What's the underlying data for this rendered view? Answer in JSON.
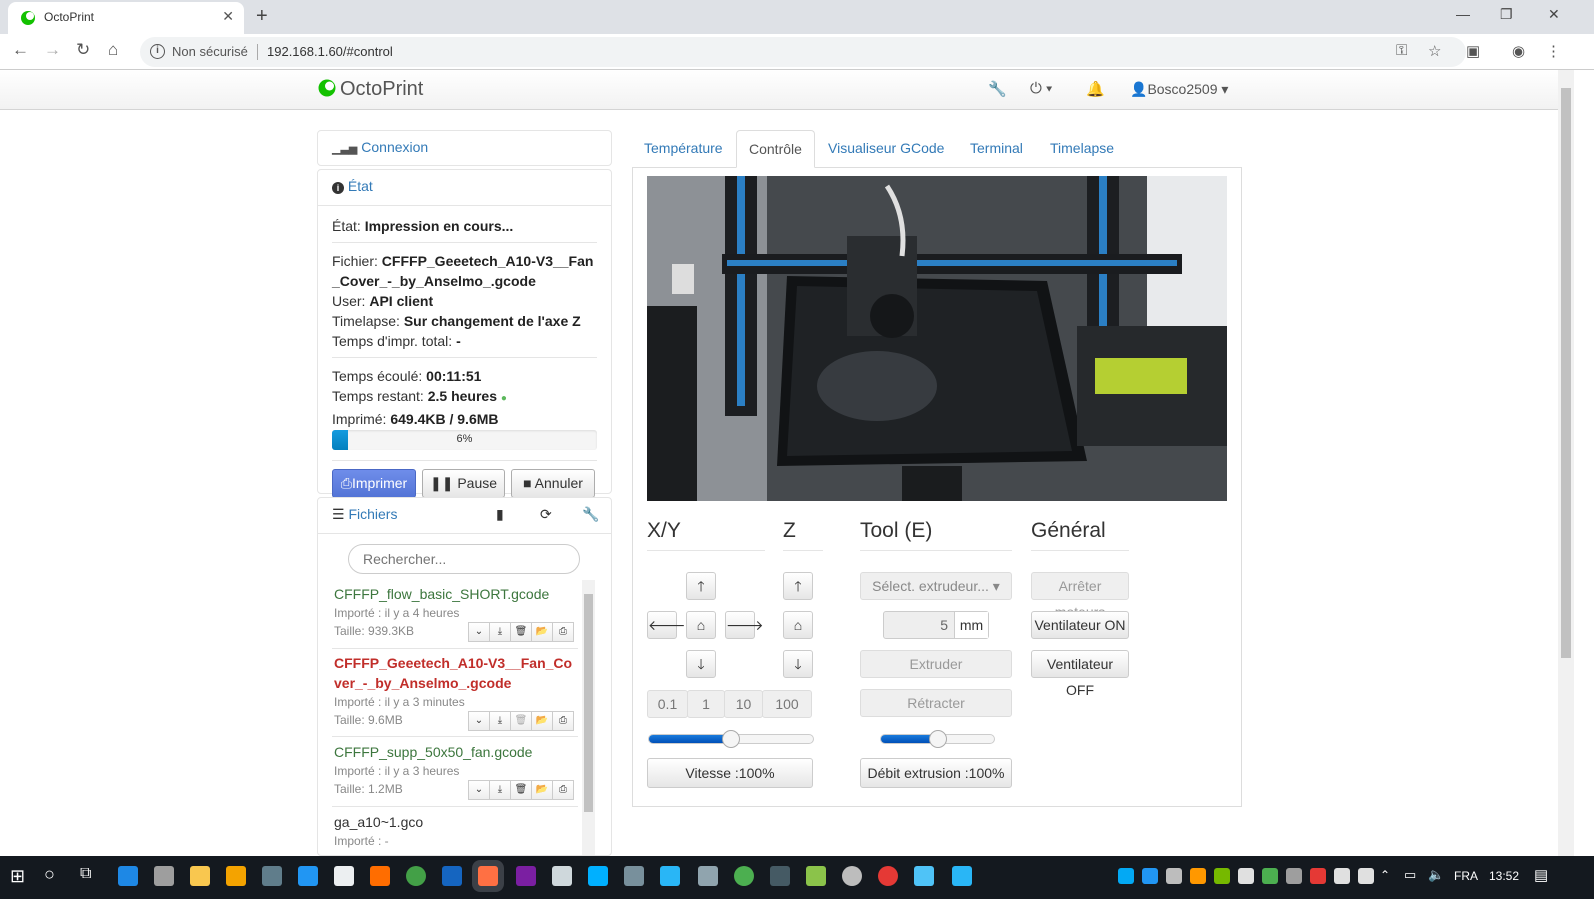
{
  "browser": {
    "tab_title": "OctoPrint",
    "security": "Non sécurisé",
    "url": "192.168.1.60/#control"
  },
  "navbar": {
    "brand": "OctoPrint",
    "user": "Bosco2509"
  },
  "connection": {
    "title": "Connexion"
  },
  "state": {
    "title": "État",
    "etat_label": "État:",
    "etat_value": "Impression en cours...",
    "fichier_label": "Fichier:",
    "fichier_value": "CFFFP_Geeetech_A10-V3__Fan_Cover_-_by_Anselmo_.gcode",
    "user_label": "User:",
    "user_value": "API client",
    "timelapse_label": "Timelapse:",
    "timelapse_value": "Sur changement de l'axe Z",
    "total_label": "Temps d'impr. total:",
    "total_value": "-",
    "elapsed_label": "Temps écoulé:",
    "elapsed_value": "00:11:51",
    "left_label": "Temps restant:",
    "left_value": "2.5 heures",
    "printed_label": "Imprimé:",
    "printed_value": "649.4KB / 9.6MB",
    "progress_label": "6%",
    "progress": 6,
    "btn_print": "Imprimer",
    "btn_pause": "Pause",
    "btn_cancel": "Annuler"
  },
  "files": {
    "title": "Fichiers",
    "search_placeholder": "Rechercher...",
    "items": [
      {
        "name": "CFFFP_flow_basic_SHORT.gcode",
        "uploaded": "Importé : il y a 4 heures",
        "size": "Taille: 939.3KB"
      },
      {
        "name": "CFFFP_Geeetech_A10-V3__Fan_Co",
        "name2": "ver_-_by_Anselmo_.gcode",
        "uploaded": "Importé : il y a 3 minutes",
        "size": "Taille: 9.6MB"
      },
      {
        "name": "CFFFP_supp_50x50_fan.gcode",
        "uploaded": "Importé : il y a 3 heures",
        "size": "Taille: 1.2MB"
      },
      {
        "name": "ga_a10~1.gco",
        "uploaded": "Importé : -"
      }
    ]
  },
  "tabs": [
    "Température",
    "Contrôle",
    "Visualiseur GCode",
    "Terminal",
    "Timelapse"
  ],
  "control": {
    "xy_title": "X/Y",
    "z_title": "Z",
    "tool_title": "Tool (E)",
    "general_title": "Général",
    "steps": [
      "0.1",
      "1",
      "10",
      "100"
    ],
    "speed_label": "Vitesse :100%",
    "speed_value": 0.5,
    "extruder_select": "Sélect. extrudeur...",
    "extrude_amount": "5",
    "unit": "mm",
    "btn_extrude": "Extruder",
    "btn_retract": "Rétracter",
    "flow_label": "Débit extrusion :100%",
    "flow_value": 0.5,
    "btn_motors_off": "Arrêter moteurs",
    "btn_fan_on": "Ventilateur ON",
    "btn_fan_off": "Ventilateur OFF"
  },
  "taskbar": {
    "lang": "FRA",
    "time": "13:52"
  },
  "colors": {
    "link": "#337ab7",
    "primary": "#5374d6",
    "progress": "#0480be",
    "active_file": "#c12e2a",
    "file": "#3c763d"
  }
}
